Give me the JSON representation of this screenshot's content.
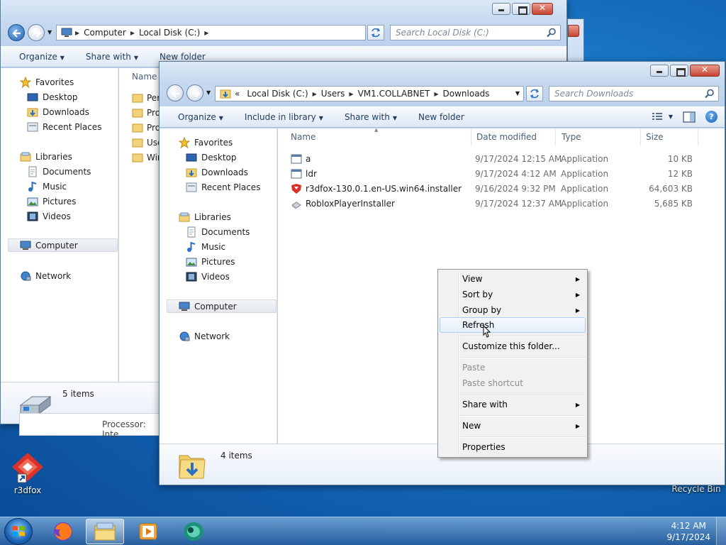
{
  "desktop": {
    "icons": [
      {
        "label": "r3dfox"
      },
      {
        "label": "Recycle Bin"
      }
    ]
  },
  "back_window": {
    "address": [
      "Computer",
      "Local Disk (C:)"
    ],
    "search_placeholder": "Search Local Disk (C:)",
    "commands": {
      "organize": "Organize",
      "share_with": "Share with",
      "new_folder": "New folder"
    },
    "nav": {
      "favorites": "Favorites",
      "desktop": "Desktop",
      "downloads": "Downloads",
      "recent_places": "Recent Places",
      "libraries": "Libraries",
      "documents": "Documents",
      "music": "Music",
      "pictures": "Pictures",
      "videos": "Videos",
      "computer": "Computer",
      "network": "Network"
    },
    "column_name": "Name",
    "folders": [
      "Per",
      "Pro",
      "Pro",
      "Use",
      "Win"
    ],
    "status": "5 items",
    "peek_text": "Processor: Inte"
  },
  "front_window": {
    "address_prefix": "«",
    "address": [
      "Local Disk (C:)",
      "Users",
      "VM1.COLLABNET",
      "Downloads"
    ],
    "search_placeholder": "Search Downloads",
    "commands": {
      "organize": "Organize",
      "include_in_library": "Include in library",
      "share_with": "Share with",
      "new_folder": "New folder"
    },
    "nav": {
      "favorites": "Favorites",
      "desktop": "Desktop",
      "downloads": "Downloads",
      "recent_places": "Recent Places",
      "libraries": "Libraries",
      "documents": "Documents",
      "music": "Music",
      "pictures": "Pictures",
      "videos": "Videos",
      "computer": "Computer",
      "network": "Network"
    },
    "columns": {
      "name": "Name",
      "date_modified": "Date modified",
      "type": "Type",
      "size": "Size"
    },
    "files": [
      {
        "name": "a",
        "date": "9/17/2024 12:15 AM",
        "type": "Application",
        "size": "10 KB",
        "icon": "app-icon"
      },
      {
        "name": "ldr",
        "date": "9/17/2024 4:12 AM",
        "type": "Application",
        "size": "12 KB",
        "icon": "app-icon"
      },
      {
        "name": "r3dfox-130.0.1.en-US.win64.installer",
        "date": "9/16/2024 9:32 PM",
        "type": "Application",
        "size": "64,603 KB",
        "icon": "r3dfox-icon"
      },
      {
        "name": "RobloxPlayerInstaller",
        "date": "9/17/2024 12:37 AM",
        "type": "Application",
        "size": "5,685 KB",
        "icon": "installer-icon"
      }
    ],
    "status": "4 items"
  },
  "context_menu": {
    "view": "View",
    "sort_by": "Sort by",
    "group_by": "Group by",
    "refresh": "Refresh",
    "customize": "Customize this folder...",
    "paste": "Paste",
    "paste_shortcut": "Paste shortcut",
    "share_with": "Share with",
    "new": "New",
    "properties": "Properties",
    "highlighted": "Refresh"
  },
  "taskbar": {
    "time": "4:12 AM",
    "date": "9/17/2024"
  }
}
